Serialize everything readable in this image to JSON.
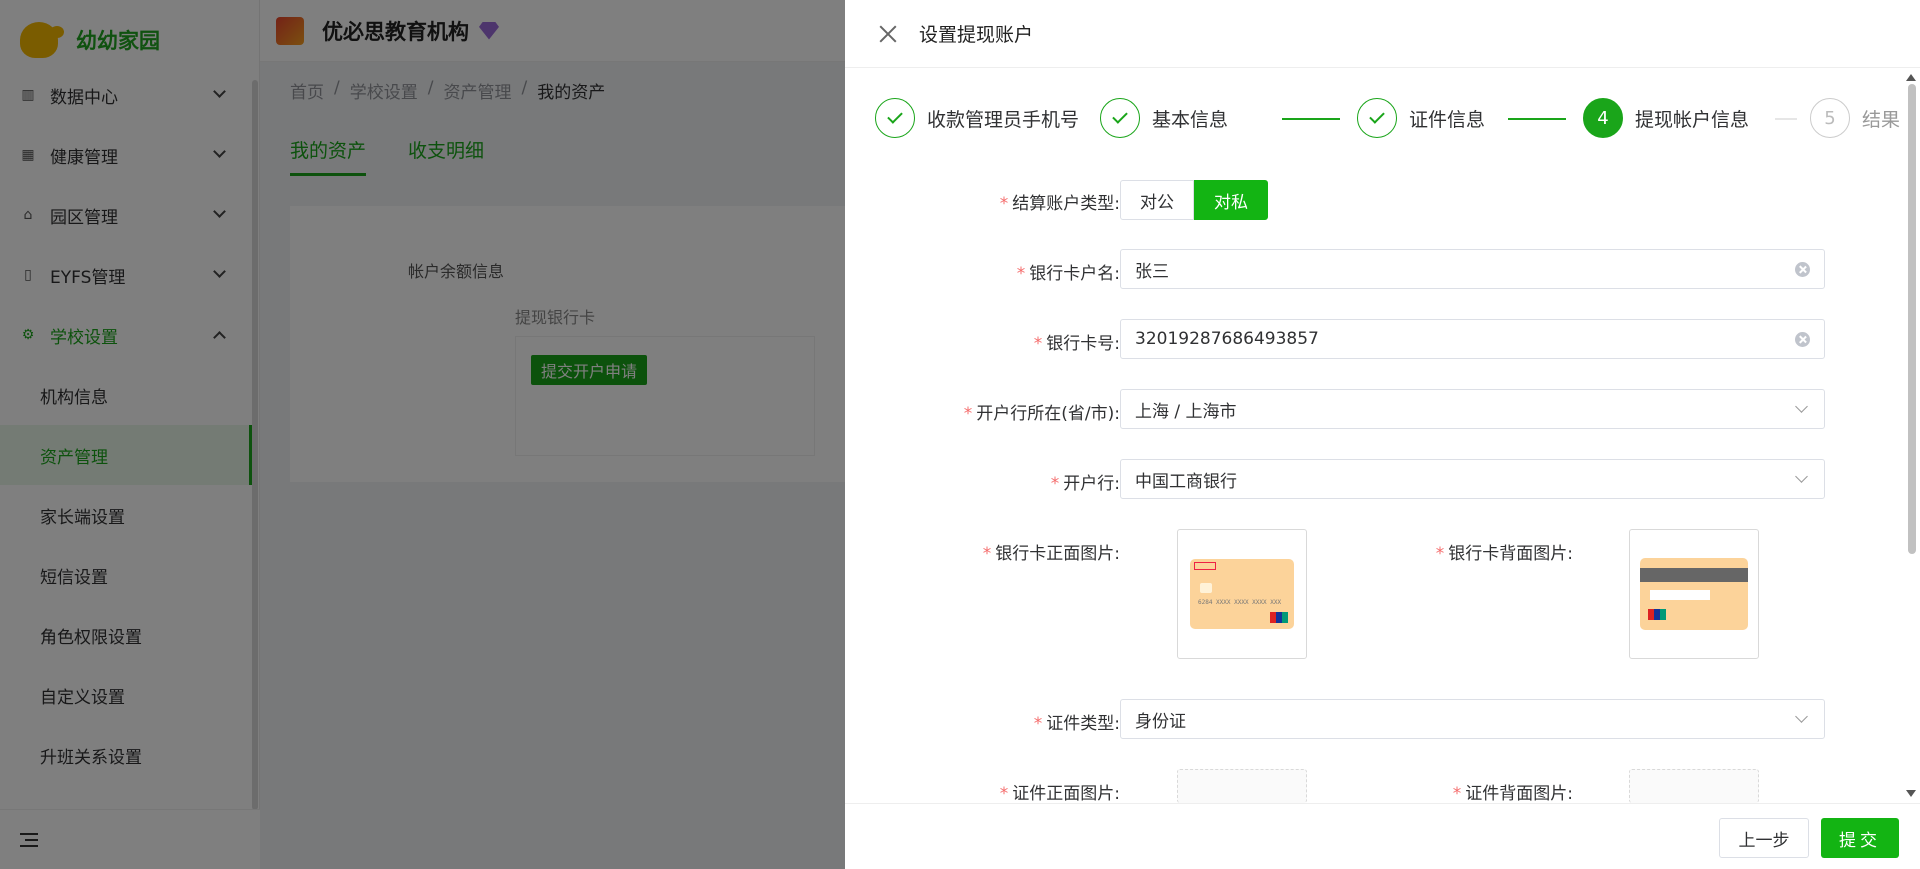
{
  "sidebar": {
    "logo_text": "幼幼家园",
    "menu": [
      {
        "label": "数据中心"
      },
      {
        "label": "健康管理"
      },
      {
        "label": "园区管理"
      },
      {
        "label": "EYFS管理"
      },
      {
        "label": "学校设置"
      }
    ],
    "sub_items": [
      {
        "label": "机构信息"
      },
      {
        "label": "资产管理"
      },
      {
        "label": "家长端设置"
      },
      {
        "label": "短信设置"
      },
      {
        "label": "角色权限设置"
      },
      {
        "label": "自定义设置"
      },
      {
        "label": "升班关系设置"
      }
    ]
  },
  "header": {
    "org_name": "优必思教育机构"
  },
  "breadcrumb": [
    "首页",
    "学校设置",
    "资产管理",
    "我的资产"
  ],
  "tabs": [
    {
      "label": "我的资产"
    },
    {
      "label": "收支明细"
    }
  ],
  "content": {
    "balance_title": "帐户余额信息",
    "card_label": "提现银行卡",
    "apply_button": "提交开户申请"
  },
  "drawer": {
    "title": "设置提现账户",
    "steps": [
      {
        "label": "收款管理员手机号",
        "status": "finish"
      },
      {
        "label": "基本信息",
        "status": "finish"
      },
      {
        "label": "证件信息",
        "status": "finish"
      },
      {
        "label": "提现帐户信息",
        "status": "process",
        "number": "4"
      },
      {
        "label": "结果",
        "status": "wait",
        "number": "5"
      }
    ],
    "form": {
      "account_type_label": "结算账户类型:",
      "account_type_options": [
        "对公",
        "对私"
      ],
      "account_type_selected": "对私",
      "holder_label": "银行卡户名:",
      "holder_value": "张三",
      "card_no_label": "银行卡号:",
      "card_no_value": "32019287686493857",
      "region_label": "开户行所在(省/市):",
      "region_value": "上海 / 上海市",
      "bank_label": "开户行:",
      "bank_value": "中国工商银行",
      "card_front_label": "银行卡正面图片:",
      "card_back_label": "银行卡背面图片:",
      "id_type_label": "证件类型:",
      "id_type_value": "身份证",
      "id_front_label": "证件正面图片:",
      "id_back_label": "证件背面图片:"
    },
    "footer": {
      "prev_label": "上一步",
      "submit_label": "提交"
    }
  },
  "colors": {
    "primary": "#1aa51a",
    "required": "#f56c6c"
  }
}
